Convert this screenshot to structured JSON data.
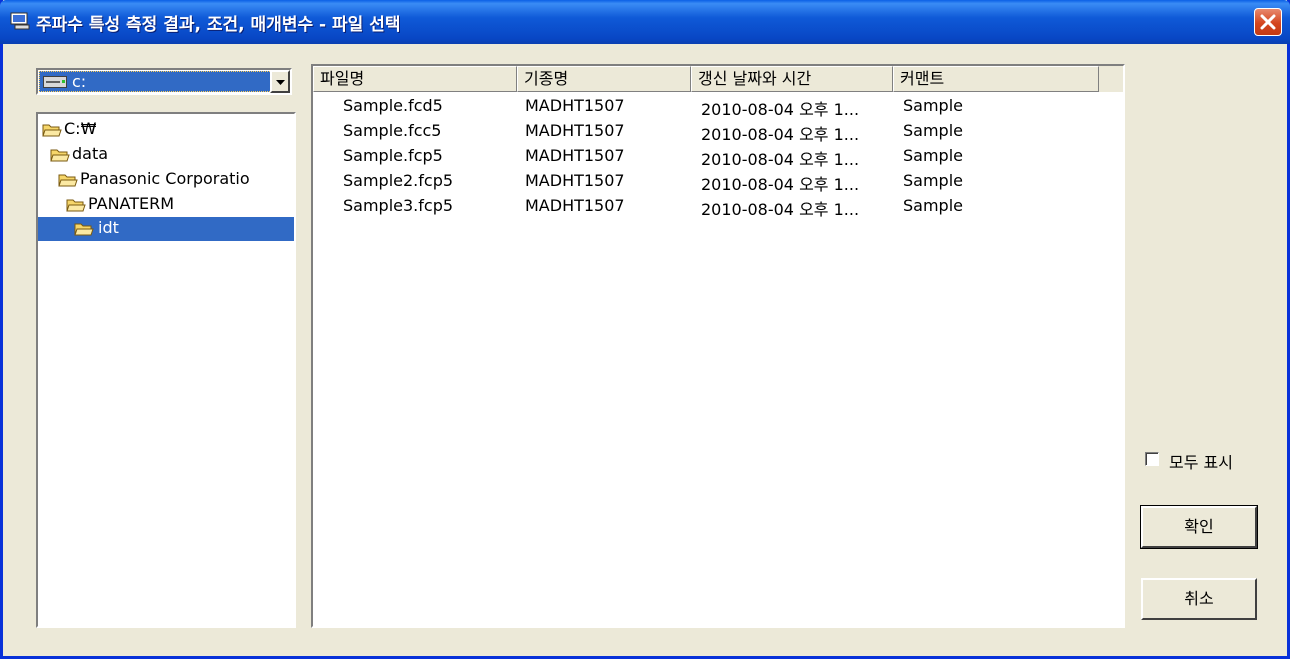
{
  "window": {
    "title": "주파수 특성 측정 결과, 조건, 매개변수 - 파일 선택"
  },
  "drive_combo": {
    "value": "c:"
  },
  "folder_tree": {
    "items": [
      {
        "label": "C:\\",
        "display": "C:₩",
        "selected": false
      },
      {
        "label": "data",
        "selected": false
      },
      {
        "label": "Panasonic Corporatio",
        "selected": false
      },
      {
        "label": "PANATERM",
        "selected": false
      },
      {
        "label": "idt",
        "selected": true
      }
    ]
  },
  "file_list": {
    "columns": [
      "파일명",
      "기종명",
      "갱신 날짜와 시간",
      "커맨트"
    ],
    "rows": [
      [
        "Sample.fcd5",
        "MADHT1507",
        "2010-08-04 오후 1...",
        "Sample"
      ],
      [
        "Sample.fcc5",
        "MADHT1507",
        "2010-08-04 오후 1...",
        "Sample"
      ],
      [
        "Sample.fcp5",
        "MADHT1507",
        "2010-08-04 오후 1...",
        "Sample"
      ],
      [
        "Sample2.fcp5",
        "MADHT1507",
        "2010-08-04 오후 1...",
        "Sample"
      ],
      [
        "Sample3.fcp5",
        "MADHT1507",
        "2010-08-04 오후 1...",
        "Sample"
      ]
    ]
  },
  "show_all": {
    "label": "모두 표시",
    "checked": false
  },
  "buttons": {
    "ok": "확인",
    "cancel": "취소"
  },
  "colors": {
    "title_bar": "#0a5fe6",
    "selection": "#316ac5",
    "close_button": "#d4461f",
    "window_bg": "#ece9d8"
  }
}
